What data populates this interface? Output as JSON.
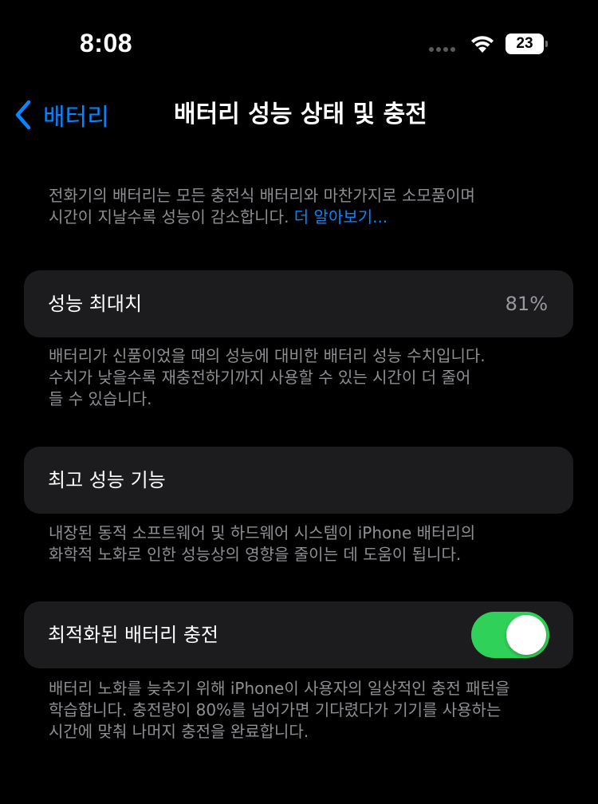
{
  "status_bar": {
    "time": "8:08",
    "battery_level": "23",
    "icons": [
      "cellular-dots-icon",
      "wifi-icon",
      "battery-icon"
    ]
  },
  "nav": {
    "back_label": "배터리",
    "title": "배터리 성능 상태 및 충전"
  },
  "intro": {
    "line1": "전화기의 배터리는 모든 충전식 배터리와 마찬가지로 소모품이며",
    "line2": "시간이 지날수록 성능이 감소합니다.",
    "learn_more": "더 알아보기..."
  },
  "max_capacity": {
    "label": "성능 최대치",
    "value": "81%",
    "footer": [
      "배터리가 신품이었을 때의 성능에 대비한 배터리 성능 수치입니다.",
      "수치가 낮을수록 재충전하기까지 사용할 수 있는 시간이 더 줄어",
      "들 수 있습니다."
    ]
  },
  "peak_performance": {
    "label": "최고 성능 기능",
    "footer": [
      "내장된 동적 소프트웨어 및 하드웨어 시스템이 iPhone 배터리의",
      "화학적 노화로 인한 성능상의 영향을 줄이는 데 도움이 됩니다."
    ]
  },
  "optimized_charging": {
    "label": "최적화된 배터리 충전",
    "enabled": true,
    "footer": [
      "배터리 노화를 늦추기 위해 iPhone이 사용자의 일상적인 충전 패턴을",
      "학습합니다. 충전량이 80%를 넘어가면 기다렸다가 기기를 사용하는",
      "시간에 맞춰 나머지 충전을 완료합니다."
    ]
  },
  "colors": {
    "background": "#000000",
    "card": "#1c1c1e",
    "accent_blue": "#0a84ff",
    "toggle_on": "#30d158",
    "secondary_text": "#8e8e93"
  }
}
